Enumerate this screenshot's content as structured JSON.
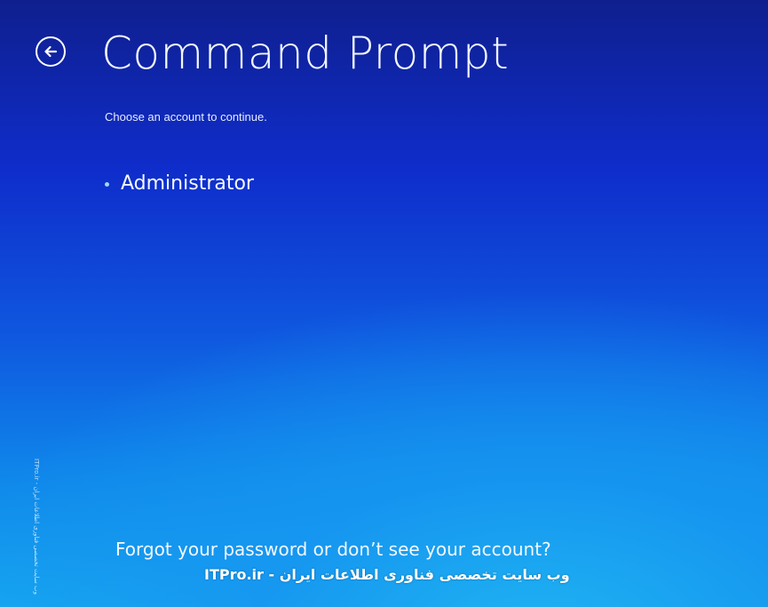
{
  "header": {
    "back_icon": "back-arrow-icon",
    "title": "Command Prompt"
  },
  "prompt": {
    "subtitle": "Choose an account to continue."
  },
  "accounts": [
    {
      "name": "Administrator"
    }
  ],
  "footer": {
    "forgot_link": "Forgot your password or don’t see your account?"
  },
  "watermark": {
    "text": "ITPro.ir - وب سایت تخصصی فناوری اطلاعات ایران",
    "side_text": "ITPro.ir - وب سایت تخصصی فناوری اطلاعات ایران"
  },
  "colors": {
    "background_top": "#0f1f8e",
    "background_bottom": "#16a6f0",
    "text": "#ffffff",
    "bullet": "#9fd7ff"
  }
}
